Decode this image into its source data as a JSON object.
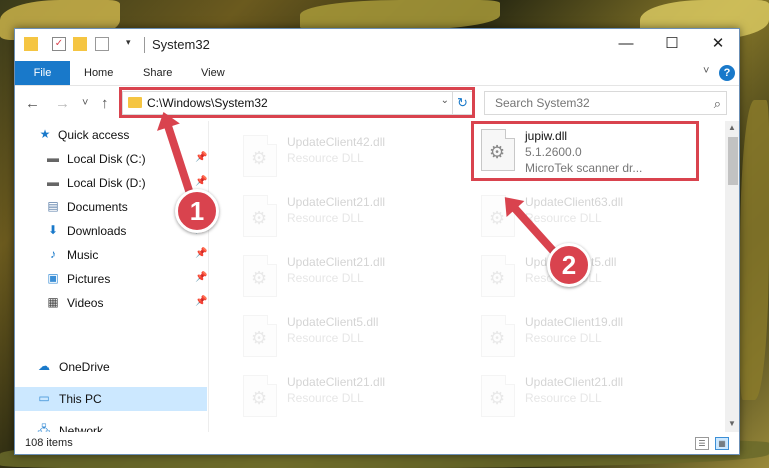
{
  "window": {
    "title": "System32",
    "controls": {
      "minimize": "—",
      "maximize": "☐",
      "close": "✕"
    }
  },
  "ribbon": {
    "tabs": [
      {
        "label": "File"
      },
      {
        "label": "Home"
      },
      {
        "label": "Share"
      },
      {
        "label": "View"
      }
    ],
    "expand_glyph": "˅",
    "help_glyph": "?"
  },
  "navigation": {
    "back": "←",
    "forward": "→",
    "recent": "˅",
    "up": "↑",
    "address": "C:\\Windows\\System32",
    "refresh": "↻",
    "search_placeholder": "Search System32"
  },
  "sidebar": {
    "items": [
      {
        "label": "Quick access",
        "icon": "star-icon"
      },
      {
        "label": "Local Disk (C:)",
        "icon": "drive-icon",
        "pinned": true
      },
      {
        "label": "Local Disk (D:)",
        "icon": "drive-icon",
        "pinned": true
      },
      {
        "label": "Documents",
        "icon": "documents-icon",
        "pinned": true
      },
      {
        "label": "Downloads",
        "icon": "downloads-icon",
        "pinned": true
      },
      {
        "label": "Music",
        "icon": "music-icon",
        "pinned": true
      },
      {
        "label": "Pictures",
        "icon": "pictures-icon",
        "pinned": true
      },
      {
        "label": "Videos",
        "icon": "videos-icon",
        "pinned": true
      },
      {
        "label": "OneDrive",
        "icon": "cloud-icon"
      },
      {
        "label": "This PC",
        "icon": "computer-icon",
        "selected": true
      },
      {
        "label": "Network",
        "icon": "network-icon"
      }
    ]
  },
  "files": [
    {
      "name": "UpdateClient42.dll",
      "type": "Resource DLL"
    },
    {
      "name": "jupiw.dll",
      "version": "5.1.2600.0",
      "description": "MicroTek scanner dr...",
      "highlighted": true
    },
    {
      "name": "UpdateClient21.dll",
      "type": "Resource DLL"
    },
    {
      "name": "UpdateClient63.dll",
      "type": "Resource DLL"
    },
    {
      "name": "UpdateClient21.dll",
      "type": "Resource DLL"
    },
    {
      "name": "UpdateClient5.dll",
      "type": "Resource DLL"
    },
    {
      "name": "UpdateClient5.dll",
      "type": "Resource DLL"
    },
    {
      "name": "UpdateClient19.dll",
      "type": "Resource DLL"
    },
    {
      "name": "UpdateClient21.dll",
      "type": "Resource DLL"
    },
    {
      "name": "UpdateClient21.dll",
      "type": "Resource DLL"
    }
  ],
  "status": {
    "item_count": "108 items"
  },
  "annotations": {
    "step1": "1",
    "step2": "2"
  },
  "colors": {
    "accent": "#1979ca",
    "highlight": "#d9434e",
    "selected": "#cce8ff"
  }
}
